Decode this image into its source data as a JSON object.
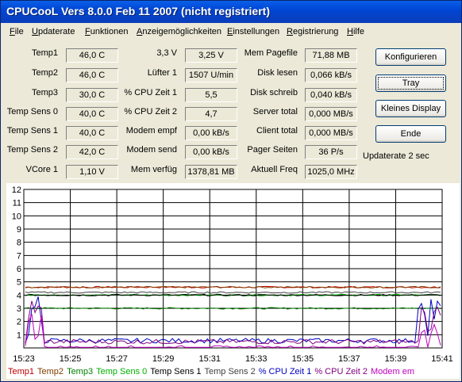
{
  "window": {
    "title": "CPUCooL  Vers 8.0.0  Feb 11 2007 (nicht registriert)"
  },
  "menu": [
    "File",
    "Updaterate",
    "Funktionen",
    "Anzeigemöglichkeiten",
    "Einstellungen",
    "Registrierung",
    "Hilfe"
  ],
  "col1": [
    {
      "label": "Temp1",
      "value": "46,0 C"
    },
    {
      "label": "Temp2",
      "value": "46,0 C"
    },
    {
      "label": "Temp3",
      "value": "30,0 C"
    },
    {
      "label": "Temp Sens 0",
      "value": "40,0 C"
    },
    {
      "label": "Temp Sens 1",
      "value": "40,0 C"
    },
    {
      "label": "Temp Sens 2",
      "value": "42,0 C"
    },
    {
      "label": "VCore 1",
      "value": "1,10 V"
    }
  ],
  "col2": [
    {
      "label": "3,3 V",
      "value": "3,25 V"
    },
    {
      "label": "Lüfter 1",
      "value": "1507 U/min"
    },
    {
      "label": "% CPU Zeit 1",
      "value": "5,5"
    },
    {
      "label": "% CPU Zeit 2",
      "value": "4,7"
    },
    {
      "label": "Modem empf",
      "value": "0,00 kB/s"
    },
    {
      "label": "Modem send",
      "value": "0,00 kB/s"
    },
    {
      "label": "Mem verfüg",
      "value": "1378,81 MB"
    }
  ],
  "col3": [
    {
      "label": "Mem Pagefile",
      "value": "71,88 MB"
    },
    {
      "label": "Disk lesen",
      "value": "0,066 kB/s"
    },
    {
      "label": "Disk schreib",
      "value": "0,040 kB/s"
    },
    {
      "label": "Server total",
      "value": "0,000 MB/s"
    },
    {
      "label": "Client total",
      "value": "0,000 MB/s"
    },
    {
      "label": "Pager Seiten",
      "value": "36 P/s"
    },
    {
      "label": "Aktuell Freq",
      "value": "1025,0 MHz"
    }
  ],
  "buttons": {
    "konfigurieren": "Konfigurieren",
    "tray": "Tray",
    "kleines_display": "Kleines Display",
    "ende": "Ende"
  },
  "updaterate_text": "Updaterate 2 sec",
  "chart_data": {
    "type": "line",
    "ylim": [
      0,
      12
    ],
    "yticks": [
      "1",
      "2",
      "3",
      "4",
      "5",
      "6",
      "7",
      "8",
      "9",
      "10",
      "11",
      "12"
    ],
    "xticks": [
      "15:23",
      "15:25",
      "15:27",
      "15:29",
      "15:31",
      "15:33",
      "15:35",
      "15:37",
      "15:39",
      "15:41"
    ],
    "grid": true,
    "legend_placement": "bottom",
    "series": [
      {
        "name": "Temp1",
        "color": "#c00000",
        "level": 4.6
      },
      {
        "name": "Temp2",
        "color": "#804000",
        "level": 4.6
      },
      {
        "name": "Temp3",
        "color": "#008000",
        "level": 3.0
      },
      {
        "name": "Temp Sens 0",
        "color": "#00b000",
        "level": 4.0
      },
      {
        "name": "Temp Sens 1",
        "color": "#000000",
        "level": 4.0
      },
      {
        "name": "Temp Sens 2",
        "color": "#404040",
        "level": 4.2
      },
      {
        "name": "% CPU Zeit 1",
        "color": "#0000c0",
        "level": 0.55
      },
      {
        "name": "% CPU Zeit 2",
        "color": "#800080",
        "level": 0.47
      },
      {
        "name": "Modem em",
        "color": "#c000c0",
        "level": 0.0
      }
    ]
  }
}
